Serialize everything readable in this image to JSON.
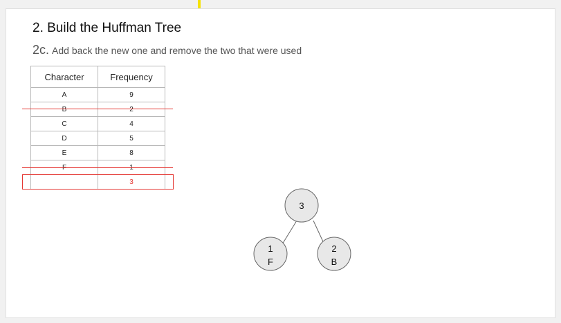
{
  "slide": {
    "title": "2. Build the Huffman Tree",
    "step_number": "2c.",
    "step_text": "Add back the new one and remove the two that were used"
  },
  "table": {
    "headers": [
      "Character",
      "Frequency"
    ],
    "rows": [
      {
        "char": "A",
        "freq": "9",
        "removed": false,
        "new": false
      },
      {
        "char": "B",
        "freq": "2",
        "removed": true,
        "new": false
      },
      {
        "char": "C",
        "freq": "4",
        "removed": false,
        "new": false
      },
      {
        "char": "D",
        "freq": "5",
        "removed": false,
        "new": false
      },
      {
        "char": "E",
        "freq": "8",
        "removed": false,
        "new": false
      },
      {
        "char": "F",
        "freq": "1",
        "removed": true,
        "new": false
      },
      {
        "char": "",
        "freq": "3",
        "removed": false,
        "new": true
      }
    ]
  },
  "tree": {
    "root": {
      "label": "3"
    },
    "left": {
      "value": "1",
      "char": "F"
    },
    "right": {
      "value": "2",
      "char": "B"
    }
  },
  "colors": {
    "strike": "#e53935",
    "node_fill": "#e8e8e8",
    "node_stroke": "#666666"
  }
}
